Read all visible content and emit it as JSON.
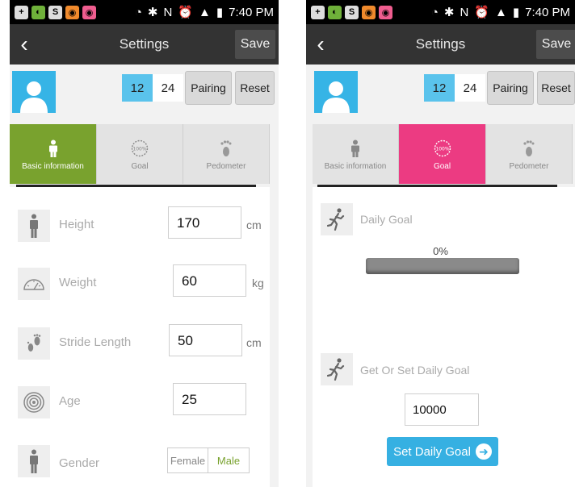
{
  "status_bar": {
    "time": "7:40 PM"
  },
  "header": {
    "title": "Settings",
    "save_label": "Save",
    "back_icon": "chevron-left-icon"
  },
  "user_bar": {
    "format_12": "12",
    "format_24": "24",
    "pairing_label": "Pairing",
    "reset_label": "Reset"
  },
  "tabs": [
    {
      "label": "Basic information",
      "icon": "person-icon"
    },
    {
      "label": "Goal",
      "icon": "goal-100-icon"
    },
    {
      "label": "Pedometer",
      "icon": "footprint-icon"
    }
  ],
  "basic_info": {
    "height": {
      "label": "Height",
      "value": "170",
      "unit": "cm"
    },
    "weight": {
      "label": "Weight",
      "value": "60",
      "unit": "kg"
    },
    "stride": {
      "label": "Stride Length",
      "value": "50",
      "unit": "cm"
    },
    "age": {
      "label": "Age",
      "value": "25"
    },
    "gender": {
      "label": "Gender",
      "female": "Female",
      "male": "Male",
      "selected": "Male"
    }
  },
  "goal": {
    "daily_goal_label": "Daily Goal",
    "progress_text": "0%",
    "progress_value": 0,
    "set_label": "Get Or Set Daily Goal",
    "goal_value": "10000",
    "set_button_label": "Set Daily Goal"
  },
  "colors": {
    "header": "#333333",
    "avatar": "#36b4e6",
    "tab_basic_active": "#79a22e",
    "tab_goal_active": "#ec3b82",
    "button_blue": "#36b0e2"
  }
}
